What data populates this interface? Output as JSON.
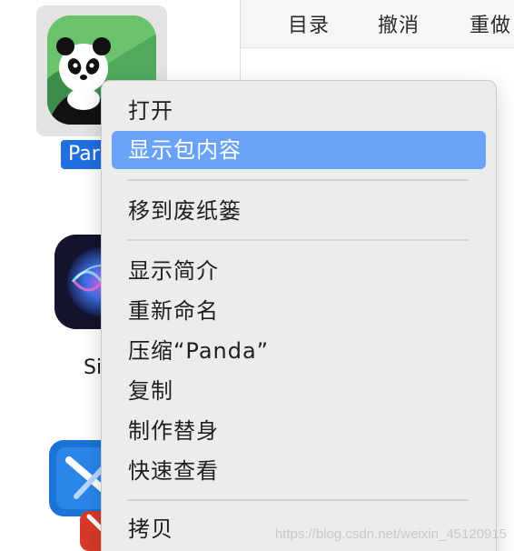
{
  "toolbar": {
    "directory_label": "目录",
    "undo_label": "撤消",
    "redo_label": "重做"
  },
  "apps": {
    "panda_label": "Par",
    "siri_label": "Si"
  },
  "context_menu": {
    "open": "打开",
    "show_package_contents": "显示包内容",
    "move_to_trash": "移到废纸篓",
    "get_info": "显示简介",
    "rename": "重新命名",
    "compress": "压缩“Panda”",
    "duplicate": "复制",
    "make_alias": "制作替身",
    "quick_look": "快速查看",
    "copy": "拷贝",
    "highlighted_item": "show_package_contents"
  },
  "watermark": "https://blog.csdn.net/weixin_45120915",
  "colors": {
    "highlight": "#6aa2f7",
    "selection_label": "#1f6fe0",
    "menu_background": "#ececec",
    "panda_icon_background": "#6cc36c"
  },
  "icons": {
    "panda": "panda-app-icon",
    "siri": "siri-app-icon",
    "tool": "xcode-like-app-icon"
  }
}
